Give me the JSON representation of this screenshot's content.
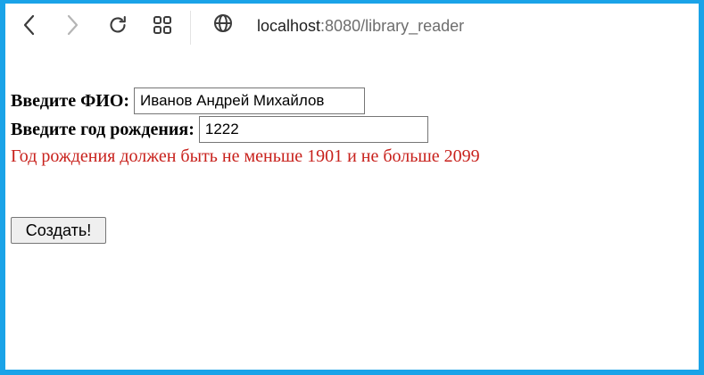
{
  "browser": {
    "url_host": "localhost",
    "url_path": ":8080/library_reader",
    "icons": {
      "back": "back-arrow-icon",
      "forward": "forward-arrow-icon",
      "reload": "reload-icon",
      "apps": "apps-grid-icon",
      "site": "globe-icon"
    },
    "frame_color": "#1aa3e8"
  },
  "form": {
    "name_label": "Введите ФИО:",
    "name_value": "Иванов Андрей Михайлов",
    "year_label": "Введите год рождения:",
    "year_value": "1222",
    "error_text": "Год рождения должен быть не меньше 1901 и не больше 2099",
    "error_color": "#c8211c",
    "submit_label": "Создать!"
  }
}
